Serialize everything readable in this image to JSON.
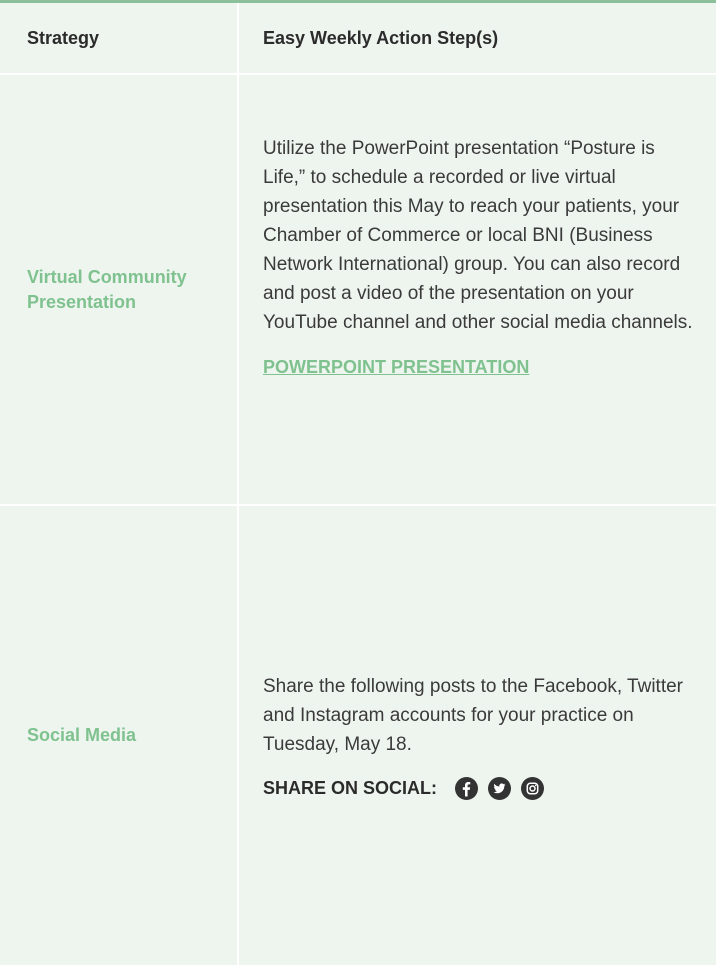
{
  "table": {
    "headers": {
      "strategy": "Strategy",
      "action": "Easy Weekly Action Step(s)"
    },
    "rows": [
      {
        "strategy": "Virtual Community Presentation",
        "description": "Utilize the PowerPoint presentation “Posture is Life,” to schedule a recorded or live virtual presentation this May to reach your patients, your Chamber of Commerce or local BNI (Business Network International) group. You can also record and post a video of the presentation on your YouTube channel and other social media channels.",
        "link_label": "POWERPOINT PRESENTATION"
      },
      {
        "strategy": "Social Media",
        "description": "Share the following posts to the Facebook, Twitter and Instagram accounts for your practice on Tuesday, May 18.",
        "share_label": "SHARE ON SOCIAL:",
        "share_icons": [
          "facebook-icon",
          "twitter-icon",
          "instagram-icon"
        ]
      }
    ]
  },
  "colors": {
    "accent": "#7fc28f",
    "table_background": "#eef5ef",
    "top_border": "#8cc09a",
    "icon_fill": "#333333"
  }
}
